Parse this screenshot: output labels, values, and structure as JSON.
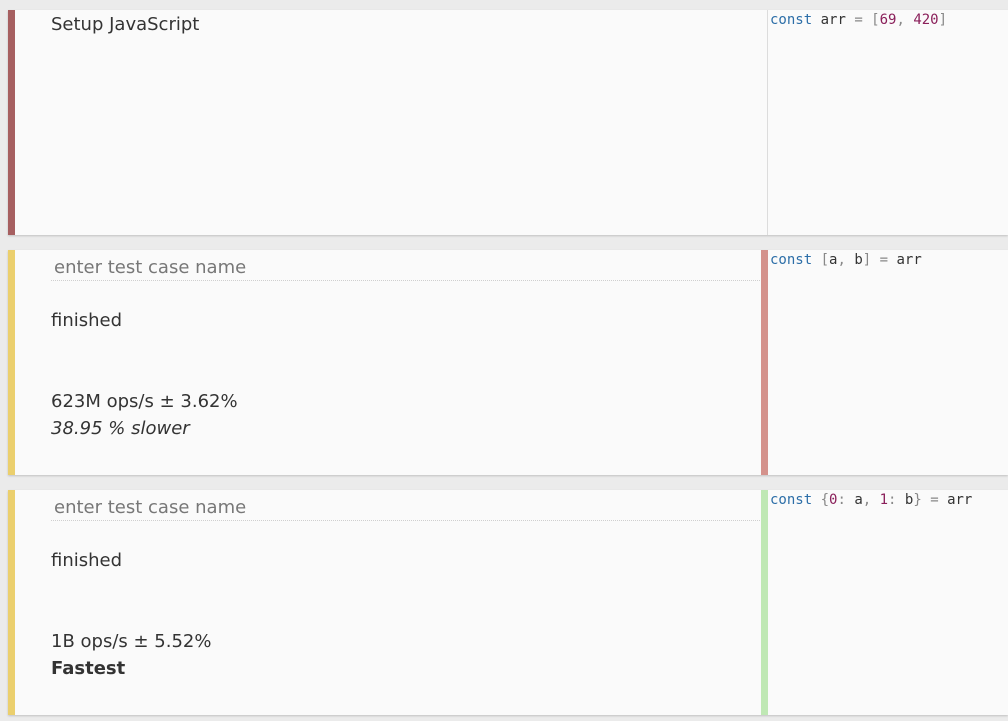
{
  "setup": {
    "title": "Setup JavaScript",
    "code": {
      "kw": "const",
      "name": " arr ",
      "eq": "=",
      "open": " [",
      "n1": "69",
      "comma": ", ",
      "n2": "420",
      "close": "]"
    },
    "accent_color": "#a65f60"
  },
  "cases": [
    {
      "name_placeholder": "enter test case name",
      "status": "finished",
      "ops": "623M ops/s ± 3.62%",
      "compare": "38.95 % slower",
      "accent_color": "#ebcf6d",
      "result_color": "#d4928c",
      "code": {
        "kw": "const",
        "open": " [",
        "a": "a",
        "comma": ", ",
        "b": "b",
        "close": "]",
        "eq": " = ",
        "rhs": "arr"
      }
    },
    {
      "name_placeholder": "enter test case name",
      "status": "finished",
      "ops": "1B ops/s ± 5.52%",
      "compare": "Fastest",
      "accent_color": "#ebcf6d",
      "result_color": "#bfe8b4",
      "code": {
        "kw": "const",
        "open": " {",
        "k0": "0",
        "colon1": ":",
        "a": " a",
        "comma": ", ",
        "k1": "1",
        "colon2": ":",
        "b": " b",
        "close": "}",
        "eq": " = ",
        "rhs": "arr"
      }
    }
  ]
}
